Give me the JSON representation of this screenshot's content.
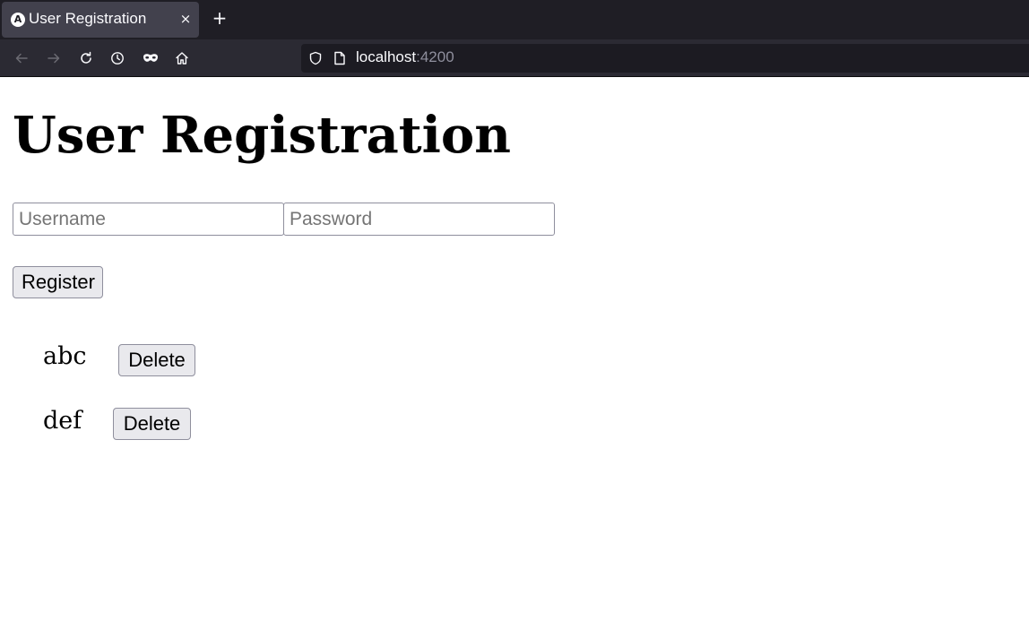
{
  "browser": {
    "tab": {
      "favicon_letter": "A",
      "title": "User Registration",
      "close_glyph": "×"
    },
    "new_tab_glyph": "+",
    "url": {
      "host": "localhost",
      "port": ":4200"
    },
    "nav_icons": [
      "back-icon",
      "forward-icon",
      "reload-icon",
      "history-icon",
      "private-browsing-icon",
      "home-icon"
    ]
  },
  "page": {
    "title": "User Registration",
    "form": {
      "username_placeholder": "Username",
      "username_value": "",
      "password_placeholder": "Password",
      "password_value": "",
      "register_label": "Register"
    },
    "users": [
      {
        "name": "abc",
        "delete_label": "Delete"
      },
      {
        "name": "def",
        "delete_label": "Delete"
      }
    ]
  }
}
